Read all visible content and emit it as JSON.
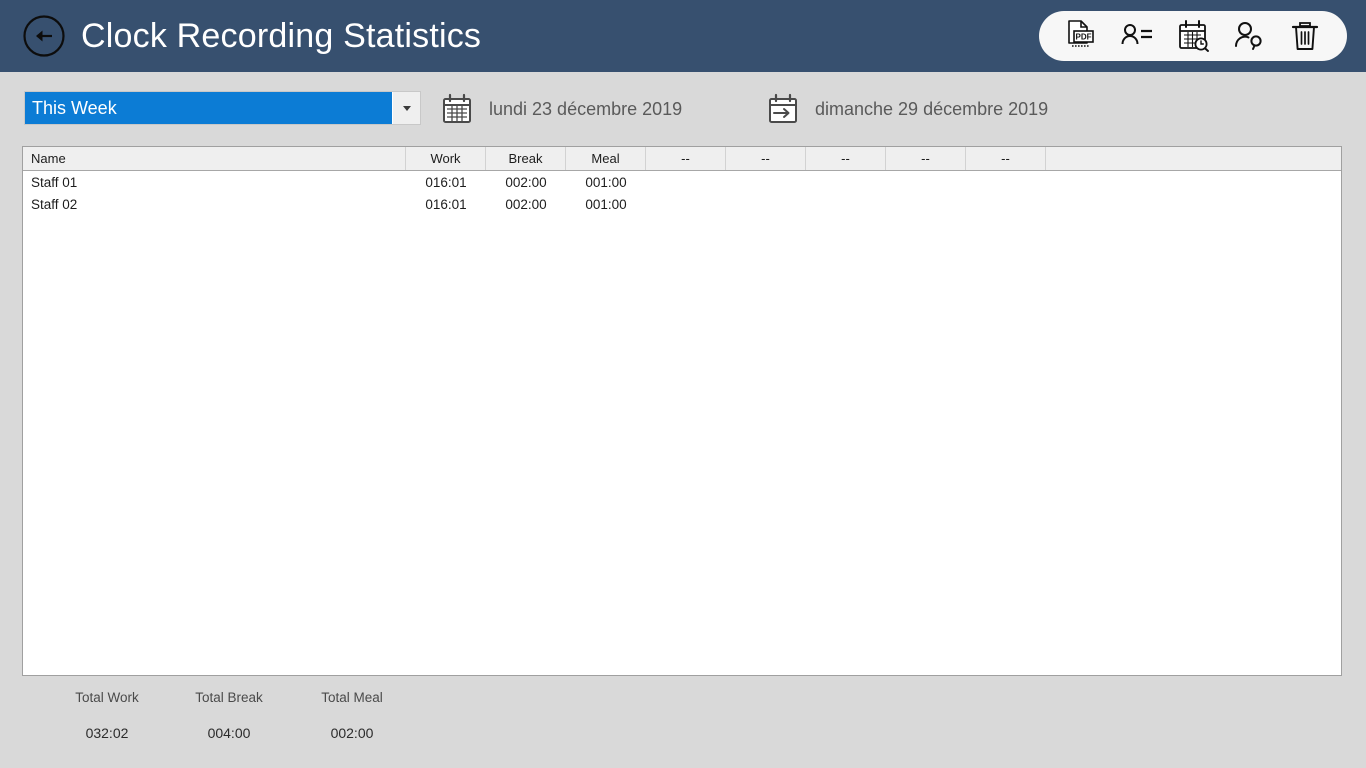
{
  "header": {
    "title": "Clock Recording Statistics",
    "back_icon": "back-arrow-circle-icon",
    "toolbar": [
      {
        "name": "export-pdf-button",
        "icon": "pdf-document-icon",
        "label": "PDF"
      },
      {
        "name": "staff-list-button",
        "icon": "person-list-icon",
        "label": ""
      },
      {
        "name": "calendar-search-button",
        "icon": "calendar-search-icon",
        "label": ""
      },
      {
        "name": "manage-users-button",
        "icon": "person-add-icon",
        "label": ""
      },
      {
        "name": "delete-button",
        "icon": "trash-icon",
        "label": ""
      }
    ]
  },
  "filters": {
    "period": {
      "selected": "This Week",
      "options": [
        "This Week"
      ]
    },
    "start_date": {
      "icon": "calendar-icon",
      "text": "lundi 23 décembre 2019"
    },
    "end_date": {
      "icon": "calendar-arrow-icon",
      "text": "dimanche 29 décembre 2019"
    }
  },
  "table": {
    "columns": [
      "Name",
      "Work",
      "Break",
      "Meal",
      "--",
      "--",
      "--",
      "--",
      "--"
    ],
    "rows": [
      {
        "name": "Staff 01",
        "work": "016:01",
        "break": "002:00",
        "meal": "001:00"
      },
      {
        "name": "Staff 02",
        "work": "016:01",
        "break": "002:00",
        "meal": "001:00"
      }
    ]
  },
  "totals": [
    {
      "label": "Total Work",
      "value": "032:02"
    },
    {
      "label": "Total Break",
      "value": "004:00"
    },
    {
      "label": "Total Meal",
      "value": "002:00"
    }
  ],
  "colors": {
    "header_bg": "#37506f",
    "accent_blue": "#0c7cd5",
    "page_bg": "#d9d9d9",
    "toolbar_bg": "#f7f7f7",
    "table_header_bg": "#efefef"
  }
}
